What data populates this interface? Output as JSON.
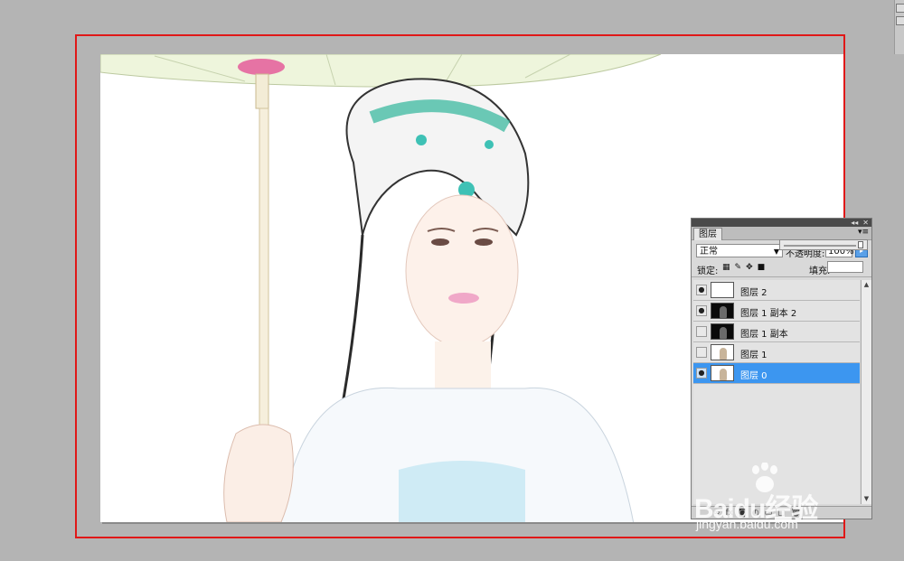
{
  "layers_panel": {
    "title": "图层",
    "blend_mode": "正常",
    "opacity_label": "不透明度:",
    "opacity_value": "100%",
    "lock_label": "锁定:",
    "fill_label": "填充:",
    "layers": [
      {
        "name": "图层 2",
        "visible": true,
        "thumb": "light",
        "selected": false
      },
      {
        "name": "图层 1 副本 2",
        "visible": true,
        "thumb": "dark",
        "selected": false
      },
      {
        "name": "图层 1 副本",
        "visible": false,
        "thumb": "dark",
        "selected": false
      },
      {
        "name": "图层 1",
        "visible": false,
        "thumb": "light",
        "selected": false
      },
      {
        "name": "图层 0",
        "visible": true,
        "thumb": "light",
        "selected": true
      }
    ]
  },
  "watermark": {
    "brand": "Baidu经验",
    "url": "jingyan.baidu.com"
  },
  "colors": {
    "workspace": "#b4b4b4",
    "selection_frame": "#e01818",
    "selected_layer": "#3c96f0"
  }
}
